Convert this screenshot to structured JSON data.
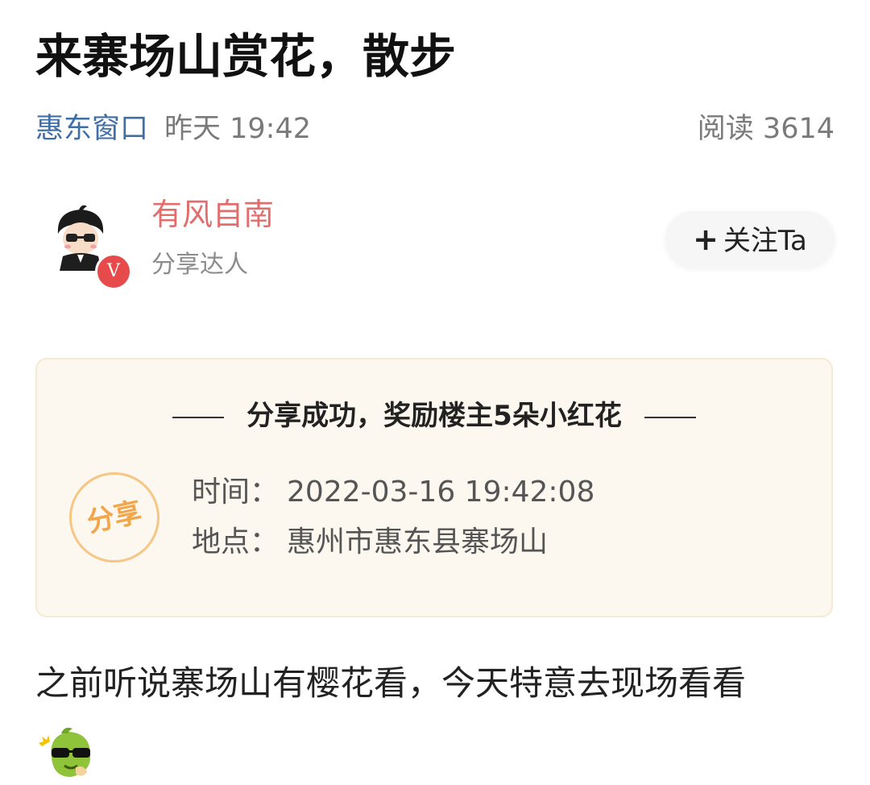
{
  "post": {
    "title": "来寨场山赏花，散步",
    "source": "惠东窗口",
    "time": "昨天 19:42",
    "reads": "阅读 3614"
  },
  "author": {
    "name": "有风自南",
    "role": "分享达人",
    "badge": "V",
    "follow_label": "关注Ta",
    "follow_icon": "+"
  },
  "share_card": {
    "heading": "分享成功，奖励楼主5朵小红花",
    "stamp_text": "分享",
    "time_label": "时间：",
    "time_value": "2022-03-16 19:42:08",
    "place_label": "地点：",
    "place_value": "惠州市惠东县寨场山"
  },
  "body": {
    "text": "之前听说寨场山有樱花看，今天特意去现场看看",
    "emoji": "cool-sunglasses-emoji"
  },
  "colors": {
    "source_link": "#3f6fa5",
    "author_name": "#e26d6d",
    "badge": "#e64a4a",
    "card_bg": "#fcf7ef",
    "stamp": "#f3a649"
  }
}
